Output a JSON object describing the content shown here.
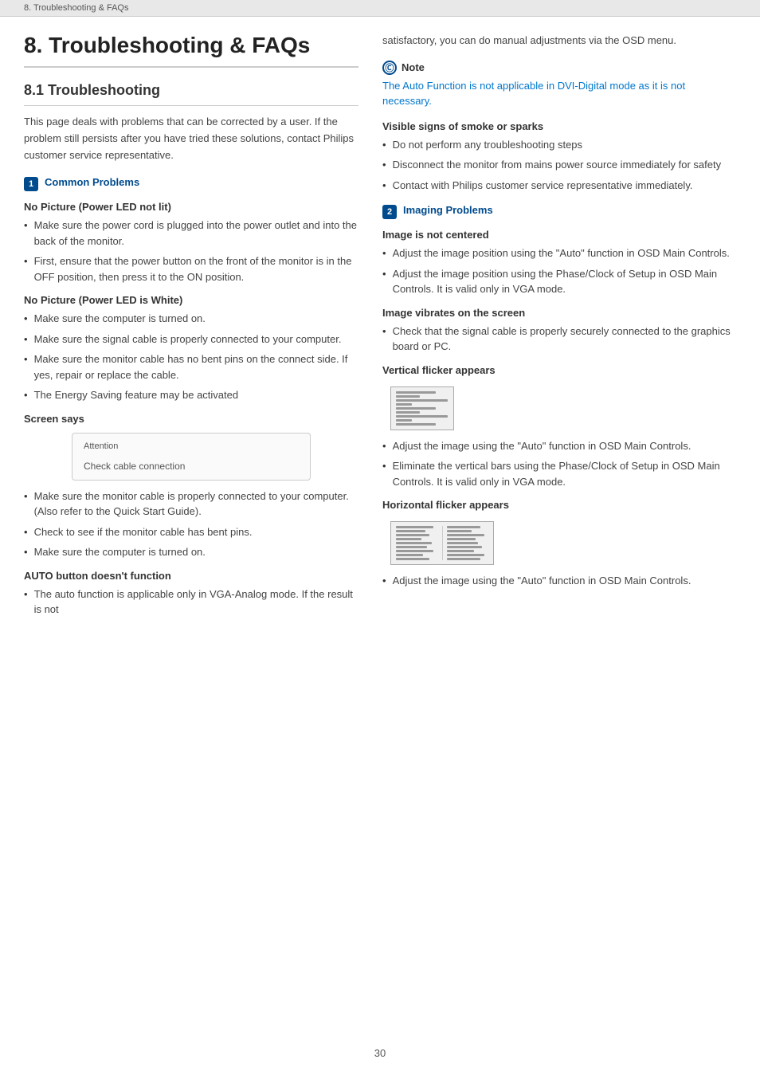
{
  "breadcrumb": "8. Troubleshooting & FAQs",
  "page_title": "8.  Troubleshooting & FAQs",
  "section_heading": "8.1  Troubleshooting",
  "intro_text": "This page deals with problems that can be corrected by a user. If the problem still persists after you have tried these solutions, contact Philips customer service representative.",
  "common_problems_label": "Common Problems",
  "common_problems_num": "1",
  "no_picture_led_off_title": "No Picture (Power LED not lit)",
  "no_picture_led_off_bullets": [
    "Make sure the power cord is plugged into the power outlet and into the back of the monitor.",
    "First, ensure that the power button on the front of the monitor is in the OFF position, then press it to the ON position."
  ],
  "no_picture_led_white_title": "No Picture (Power LED is White)",
  "no_picture_led_white_bullets": [
    "Make sure the computer is turned on.",
    "Make sure the signal cable is properly connected to your computer.",
    "Make sure the monitor cable has no bent pins on the connect side. If yes, repair or replace the cable.",
    "The Energy Saving feature may be activated"
  ],
  "screen_says_title": "Screen says",
  "screen_attention_label": "Attention",
  "screen_check_cable": "Check cable connection",
  "screen_says_bullets": [
    "Make sure the monitor cable is properly connected to your computer. (Also refer to the Quick Start Guide).",
    "Check to see if the monitor cable has bent pins.",
    "Make sure the computer is turned on."
  ],
  "auto_button_title": "AUTO button doesn't function",
  "auto_button_bullets": [
    "The auto function is applicable only in VGA-Analog mode.  If the result is not"
  ],
  "right_col_cont_text": "satisfactory, you can do manual adjustments via the OSD menu.",
  "note_label": "Note",
  "note_text": "The Auto Function is not applicable in DVI-Digital mode as it is not necessary.",
  "visible_signs_title": "Visible signs of smoke or sparks",
  "visible_signs_bullets": [
    "Do not perform any troubleshooting steps",
    "Disconnect the monitor from mains power source immediately for safety",
    "Contact with Philips customer service representative immediately."
  ],
  "imaging_problems_num": "2",
  "imaging_problems_label": "Imaging Problems",
  "image_not_centered_title": "Image is not centered",
  "image_not_centered_bullets": [
    "Adjust the image position using the \"Auto\" function in OSD Main Controls.",
    "Adjust the image position using the Phase/Clock of Setup in OSD Main Controls.  It is valid only in VGA mode."
  ],
  "image_vibrates_title": "Image vibrates on the screen",
  "image_vibrates_bullets": [
    "Check that the signal cable is properly securely connected to the graphics board or PC."
  ],
  "vertical_flicker_title": "Vertical flicker appears",
  "vertical_flicker_bullets": [
    "Adjust the image using the \"Auto\" function in OSD Main Controls.",
    "Eliminate the vertical bars using the Phase/Clock of Setup in OSD Main Controls. It is valid only in VGA mode."
  ],
  "horizontal_flicker_title": "Horizontal flicker appears",
  "horizontal_flicker_bullets": [
    "Adjust the image using the \"Auto\" function in OSD Main Controls."
  ],
  "page_number": "30"
}
